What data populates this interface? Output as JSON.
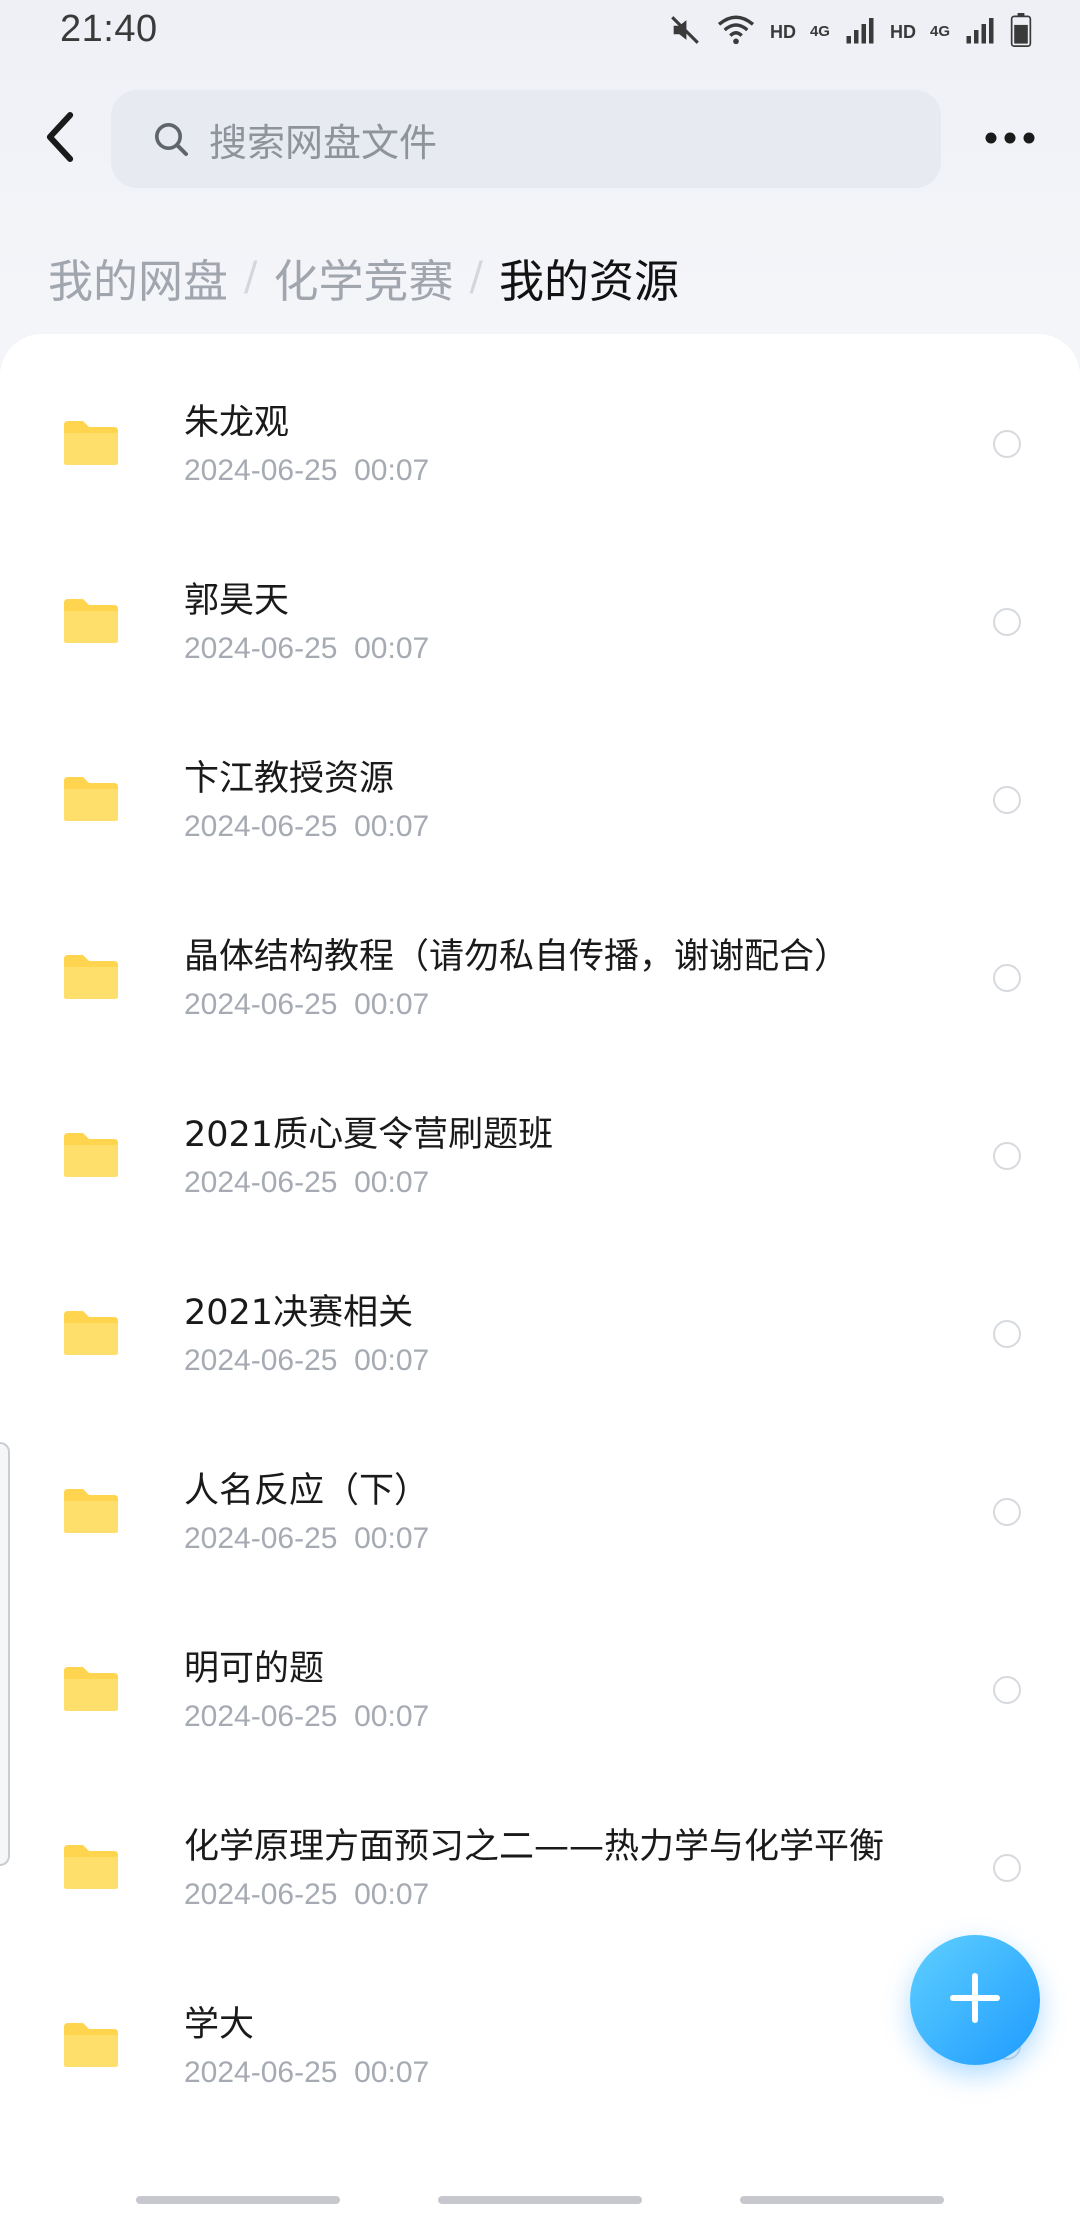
{
  "status_bar": {
    "time": "21:40",
    "hd1": "HD",
    "net1": "4G",
    "hd2": "HD",
    "net2": "4G"
  },
  "header": {
    "back_icon": "chevron-left-icon",
    "search_placeholder": "搜索网盘文件",
    "search_icon": "search-icon",
    "more_icon": "more-horizontal-icon"
  },
  "breadcrumb": [
    {
      "label": "我的网盘"
    },
    {
      "label": "化学竞赛"
    },
    {
      "label": "我的资源"
    }
  ],
  "breadcrumb_separator": "/",
  "files": [
    {
      "name": "朱龙观",
      "date": "2024-06-25  00:07",
      "icon": "folder-icon"
    },
    {
      "name": "郭昊天",
      "date": "2024-06-25  00:07",
      "icon": "folder-icon"
    },
    {
      "name": "卞江教授资源",
      "date": "2024-06-25  00:07",
      "icon": "folder-icon"
    },
    {
      "name": "晶体结构教程（请勿私自传播，谢谢配合）",
      "date": "2024-06-25  00:07",
      "icon": "folder-icon"
    },
    {
      "name": "2021质心夏令营刷题班",
      "date": "2024-06-25  00:07",
      "icon": "folder-icon"
    },
    {
      "name": "2021决赛相关",
      "date": "2024-06-25  00:07",
      "icon": "folder-icon"
    },
    {
      "name": "人名反应（下）",
      "date": "2024-06-25  00:07",
      "icon": "folder-icon"
    },
    {
      "name": "明可的题",
      "date": "2024-06-25  00:07",
      "icon": "folder-icon"
    },
    {
      "name": "化学原理方面预习之二——热力学与化学平衡",
      "date": "2024-06-25  00:07",
      "icon": "folder-icon"
    },
    {
      "name": "学大",
      "date": "2024-06-25  00:07",
      "icon": "folder-icon"
    }
  ],
  "fab_icon": "plus-icon",
  "colors": {
    "folder": "#ffd54f",
    "accent": "#1e9bff",
    "search_bg": "#e8eaf1"
  }
}
